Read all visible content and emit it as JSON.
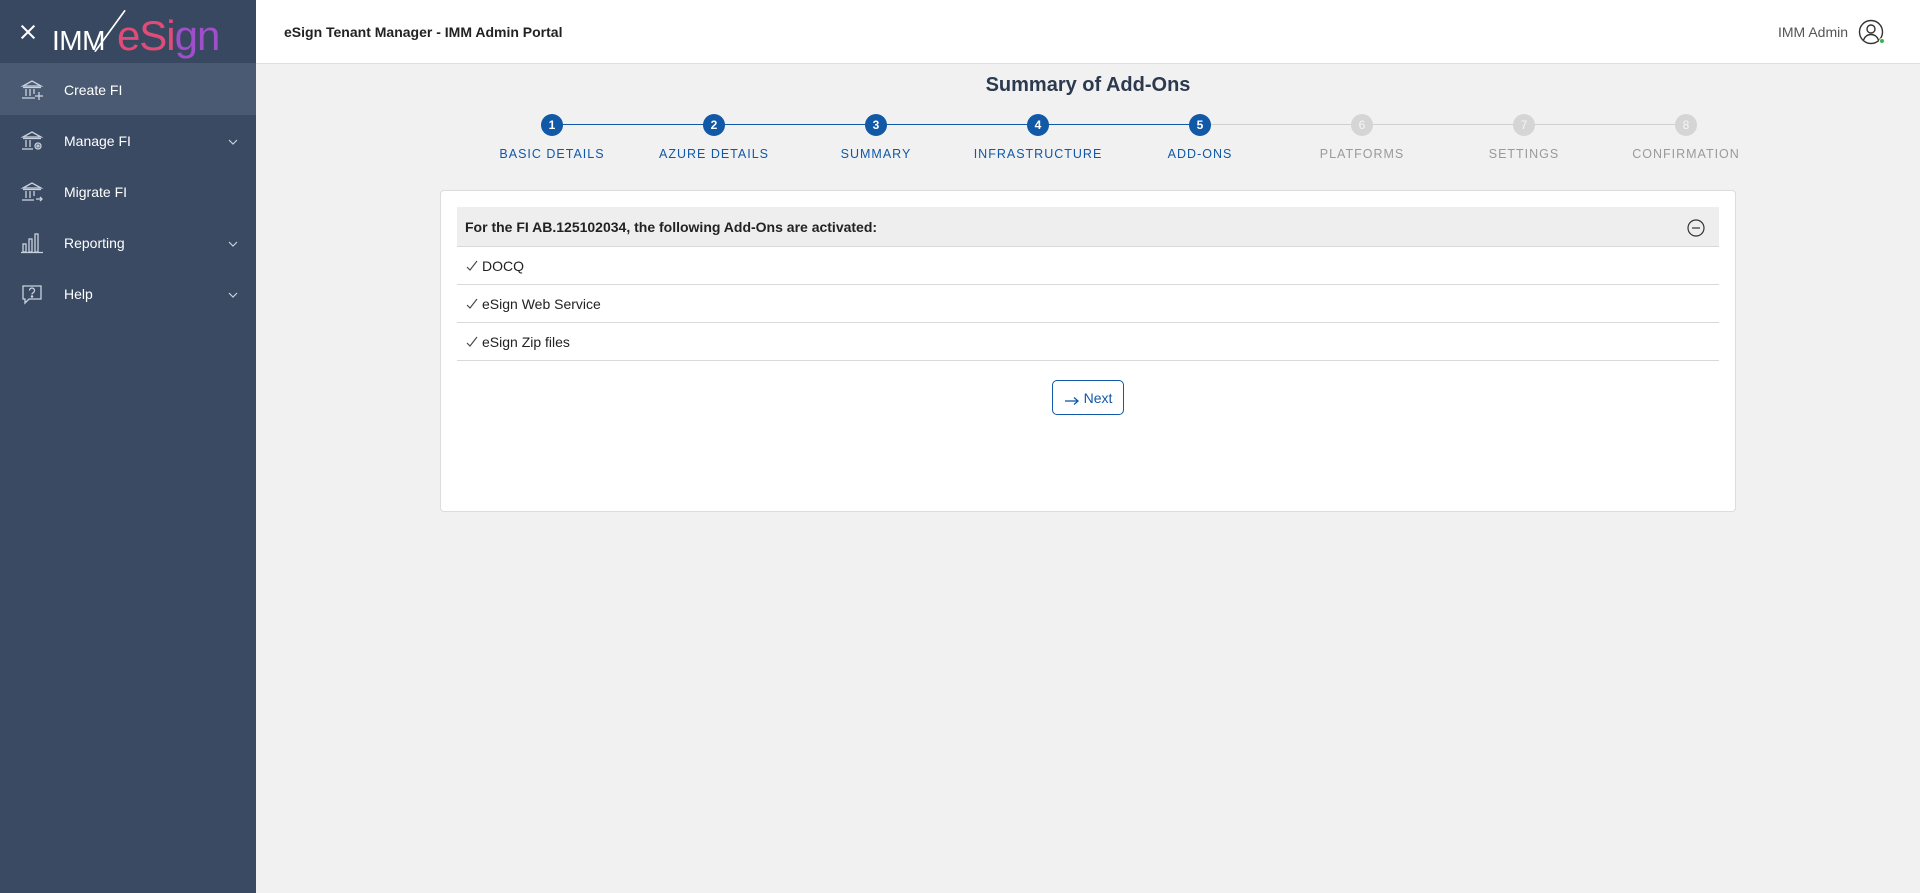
{
  "sidebar": {
    "logo": {
      "imm": "IMM",
      "esign_e": "eSi",
      "esign_g": "gn"
    },
    "items": [
      {
        "label": "Create FI",
        "icon": "bank-plus-icon",
        "active": true,
        "expandable": false
      },
      {
        "label": "Manage FI",
        "icon": "bank-gear-icon",
        "active": false,
        "expandable": true
      },
      {
        "label": "Migrate FI",
        "icon": "bank-arrow-icon",
        "active": false,
        "expandable": false
      },
      {
        "label": "Reporting",
        "icon": "bar-chart-icon",
        "active": false,
        "expandable": true
      },
      {
        "label": "Help",
        "icon": "help-icon",
        "active": false,
        "expandable": true
      }
    ]
  },
  "header": {
    "title": "eSign Tenant Manager - IMM Admin Portal",
    "user_name": "IMM Admin"
  },
  "main": {
    "page_title": "Summary of Add-Ons",
    "steps": [
      {
        "number": "1",
        "label": "BASIC DETAILS",
        "done": true
      },
      {
        "number": "2",
        "label": "AZURE DETAILS",
        "done": true
      },
      {
        "number": "3",
        "label": "SUMMARY",
        "done": true
      },
      {
        "number": "4",
        "label": "INFRASTRUCTURE",
        "done": true
      },
      {
        "number": "5",
        "label": "ADD-ONS",
        "done": true
      },
      {
        "number": "6",
        "label": "PLATFORMS",
        "done": false
      },
      {
        "number": "7",
        "label": "SETTINGS",
        "done": false
      },
      {
        "number": "8",
        "label": "CONFIRMATION",
        "done": false
      }
    ],
    "card": {
      "header": "For the FI AB.125102034, the following Add-Ons are activated:",
      "addons": [
        "DOCQ",
        "eSign Web Service",
        "eSign Zip files"
      ],
      "next_label": "Next"
    }
  },
  "colors": {
    "sidebar_bg": "#3a4a62",
    "accent": "#1158a7",
    "pending": "#d5d5d5",
    "logo_pink": "#e24b78",
    "logo_purple": "#a04ec9"
  }
}
